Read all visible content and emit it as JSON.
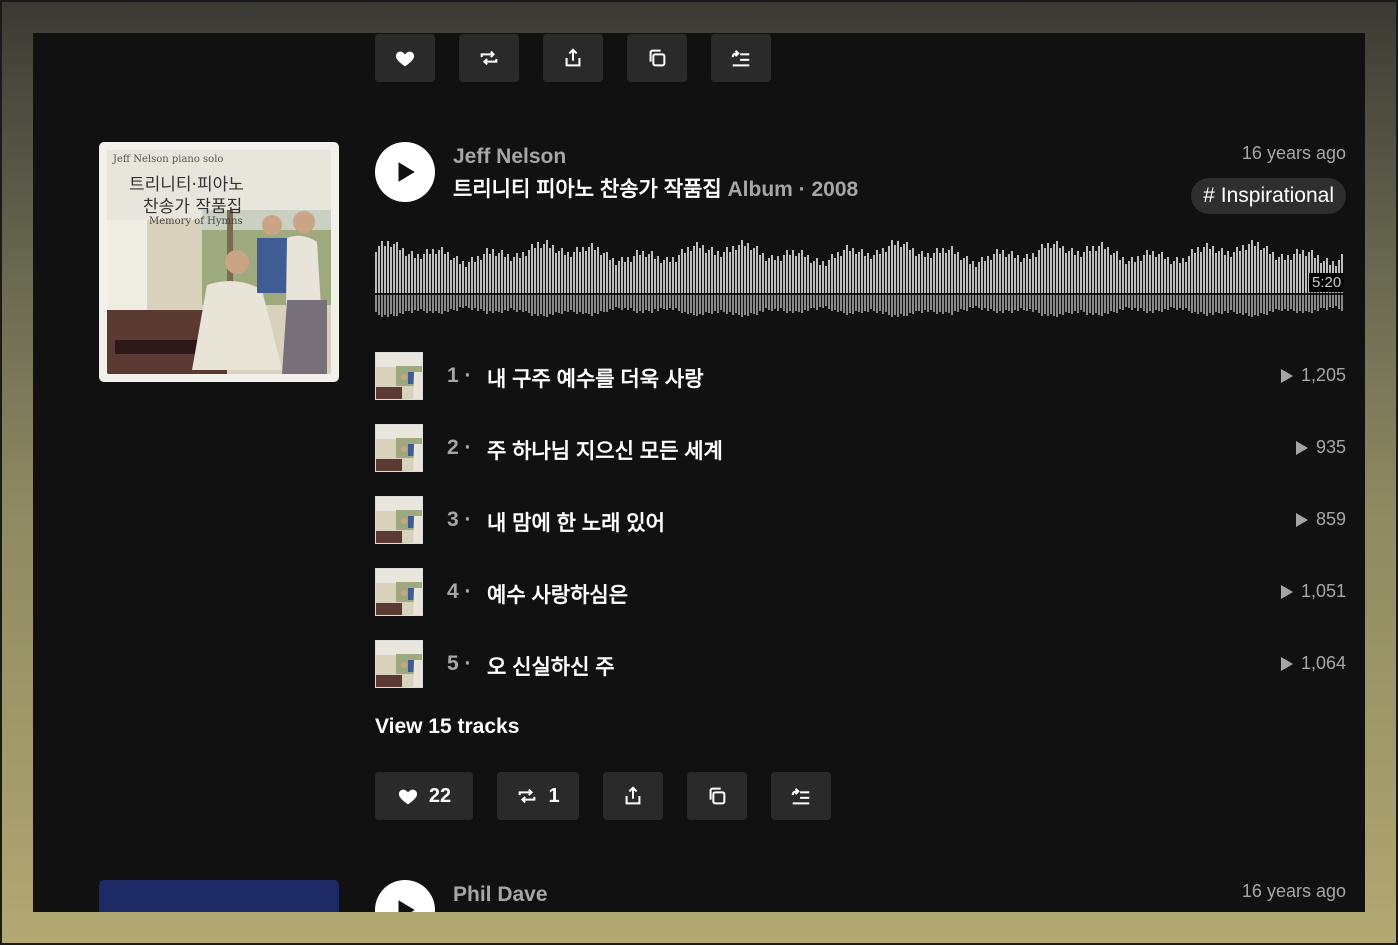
{
  "top_actions": {
    "icons": [
      "heart-icon",
      "repost-icon",
      "share-icon",
      "copy-icon",
      "add-to-queue-icon"
    ]
  },
  "post": {
    "artist": "Jeff Nelson",
    "title": "트리니티 피아노 찬송가 작품집",
    "type_year": " Album · 2008",
    "posted_ago": "16 years ago",
    "tag": "# Inspirational",
    "duration": "5:20",
    "cover": {
      "line1": "Jeff Nelson piano solo",
      "line2": "트리니티·피아노",
      "line3": "찬송가 작품집",
      "line4": "Memory of Hymns"
    },
    "tracks": [
      {
        "num": "1",
        "name": "내 구주 예수를 더욱 사랑",
        "plays": "1,205"
      },
      {
        "num": "2",
        "name": "주 하나님 지으신 모든 세계",
        "plays": "935"
      },
      {
        "num": "3",
        "name": "내 맘에 한 노래 있어",
        "plays": "859"
      },
      {
        "num": "4",
        "name": "예수 사랑하심은",
        "plays": "1,051"
      },
      {
        "num": "5",
        "name": "오 신실하신 주",
        "plays": "1,064"
      }
    ],
    "view_tracks": "View 15 tracks",
    "likes": "22",
    "reposts": "1"
  },
  "next_post": {
    "artist": "Phil Dave",
    "posted_ago": "16 years ago"
  },
  "colors": {
    "panel_bg": "#111111",
    "button_bg": "#2a2a2a",
    "muted_text": "#a6a6a6",
    "waveform": "#bdbdbd"
  }
}
